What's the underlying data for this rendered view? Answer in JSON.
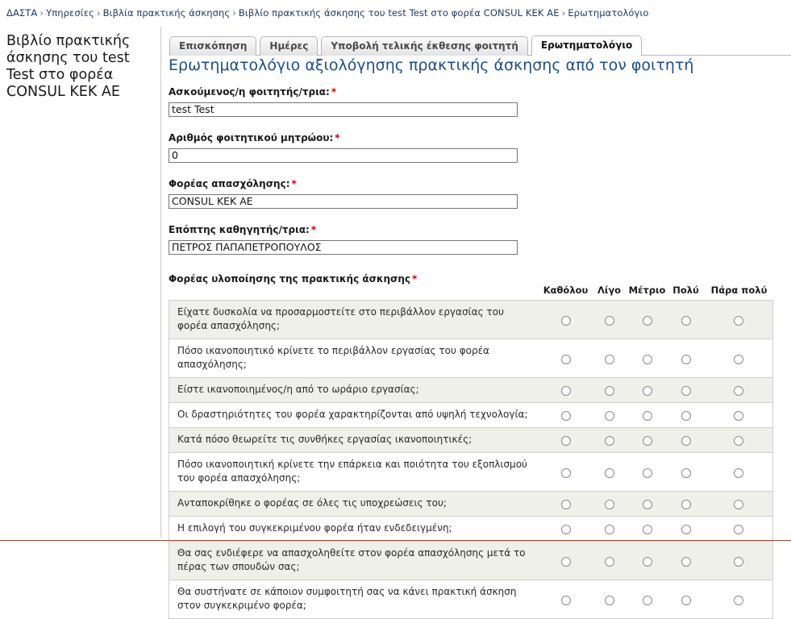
{
  "breadcrumb": {
    "separator": "›",
    "items": [
      "ΔΑΣΤΑ",
      "Υπηρεσίες",
      "Βιβλία πρακτικής άσκησης",
      "Βιβλίο πρακτικής άσκησης του test Test στο φορέα CONSUL KEK AE",
      "Ερωτηματολόγιο"
    ]
  },
  "sidebar": {
    "page_title": "Βιβλίο πρακτικής άσκησης του test Test στο φορέα CONSUL KEK AE"
  },
  "tabs": [
    {
      "label": "Επισκόπηση",
      "active": false
    },
    {
      "label": "Ημέρες",
      "active": false
    },
    {
      "label": "Υποβολή τελικής έκθεσης φοιτητή",
      "active": false
    },
    {
      "label": "Ερωτηματολόγιο",
      "active": true
    }
  ],
  "form": {
    "heading": "Ερωτηματολόγιο αξιολόγησης πρακτικής άσκησης από τον φοιτητή",
    "required_marker": "*",
    "fields": [
      {
        "label": "Ασκούμενος/η φοιτητής/τρια:",
        "value": "test Test",
        "required": true
      },
      {
        "label": "Αριθμός φοιτητικού μητρώου:",
        "value": "0",
        "required": true
      },
      {
        "label": "Φορέας απασχόλησης:",
        "value": "CONSUL KEK AE",
        "required": true
      },
      {
        "label": "Επόπτης καθηγητής/τρια:",
        "value": "ΠΕΤΡΟΣ ΠΑΠΑΠΕΤΡΟΠΟΥΛΟΣ",
        "required": true
      }
    ],
    "section_label": "Φορέας υλοποίησης της πρακτικής άσκησης",
    "section_required": true
  },
  "matrix": {
    "scale": [
      "Καθόλου",
      "Λίγο",
      "Μέτριο",
      "Πολύ",
      "Πάρα πολύ"
    ],
    "questions": [
      "Είχατε δυσκολία να προσαρμοστείτε στο περιβάλλον εργασίας του φορέα απασχόλησης;",
      "Πόσο ικανοποιητικό κρίνετε το περιβάλλον εργασίας του φορέα απασχόλησης;",
      "Είστε ικανοποιημένος/η από το ωράριο εργασίας;",
      "Οι δραστηριότητες του φορέα χαρακτηρίζονται από υψηλή τεχνολογία;",
      "Κατά πόσο θεωρείτε τις συνθήκες εργασίας ικανοποιητικές;",
      "Πόσο ικανοποιητική κρίνετε την επάρκεια και ποιότητα του εξοπλισμού του φορέα απασχόλησης;",
      "Ανταποκρίθηκε ο φορέας σε όλες τις υποχρεώσεις του;",
      "Η επιλογή του συγκεκριμένου φορέα ήταν ενδεδειγμένη;",
      "Θα σας ενδιέφερε να απασχοληθείτε στον φορέα απασχόλησης μετά το πέρας των σπουδών σας;",
      "Θα συστήνατε σε κάποιον συμφοιτητή σας να κάνει πρακτική άσκηση στον συγκεκριμένο φορέα;"
    ],
    "selected": [
      null,
      null,
      null,
      null,
      null,
      null,
      null,
      null,
      null,
      null
    ]
  },
  "colors": {
    "breadcrumb": "#1f3a68",
    "heading": "#1c4f87",
    "required": "#cc0000",
    "row_alt": "#eff0ea",
    "bottom_rule": "#a34a33"
  }
}
